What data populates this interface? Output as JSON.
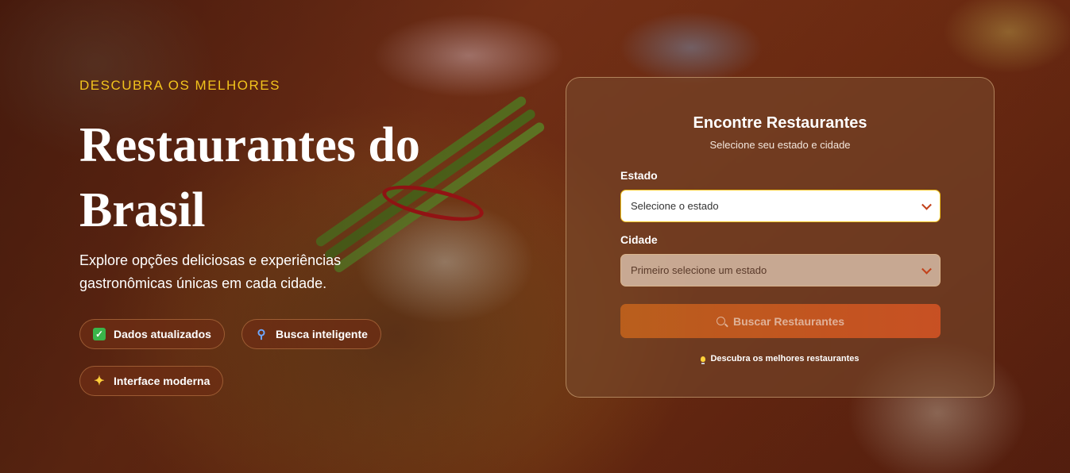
{
  "hero": {
    "eyebrow": "DESCUBRA OS MELHORES",
    "title": "Restaurantes do Brasil",
    "description": "Explore opções deliciosas e experiências gastronômicas únicas em cada cidade.",
    "features": [
      {
        "label": "Dados atualizados",
        "icon": "check-icon"
      },
      {
        "label": "Busca inteligente",
        "icon": "search-icon"
      },
      {
        "label": "Interface moderna",
        "icon": "sparkle-icon"
      }
    ]
  },
  "search_card": {
    "title": "Encontre Restaurantes",
    "subtitle": "Selecione seu estado e cidade",
    "state_label": "Estado",
    "state_value": "Selecione o estado",
    "city_label": "Cidade",
    "city_value": "Primeiro selecione um estado",
    "button_label": "Buscar Restaurantes",
    "hint": "Descubra os melhores restaurantes"
  },
  "colors": {
    "accent_yellow": "#f2c31c",
    "button_orange": "#d85524"
  }
}
